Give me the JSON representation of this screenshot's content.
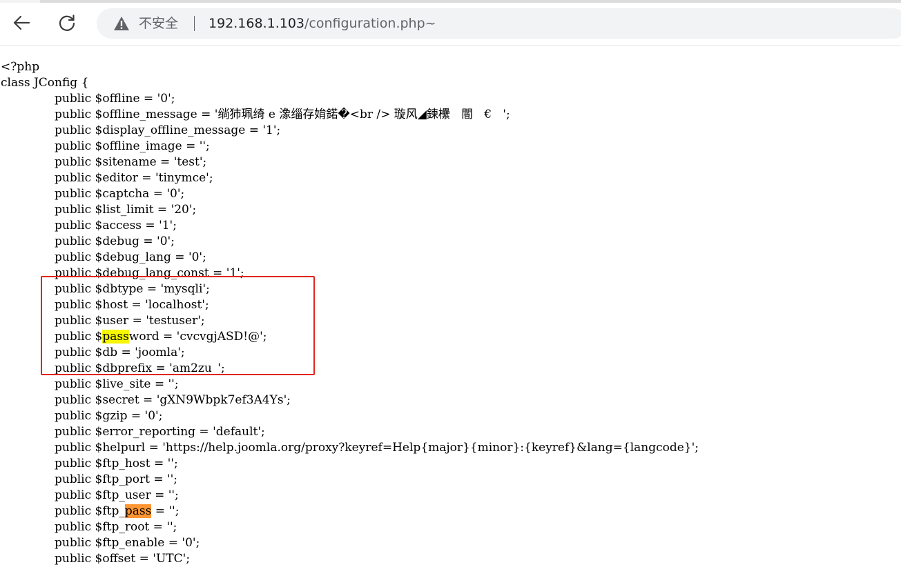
{
  "browser": {
    "security_label": "不安全",
    "url_host": "192.168.1.103",
    "url_path": "/configuration.php~"
  },
  "document": {
    "lines": [
      {
        "pre": "<?php",
        "mark": "",
        "post": "",
        "indent": false
      },
      {
        "pre": "class JConfig {",
        "mark": "",
        "post": "",
        "indent": false
      },
      {
        "pre": "public $offline = '0';",
        "mark": "",
        "post": "",
        "indent": true
      },
      {
        "pre": "public $offline_message = '绱犻珮绮 e 潒缁存姢鍩�<br /> 璇风◢鍊欙   閽   €   ';",
        "mark": "",
        "post": "",
        "indent": true
      },
      {
        "pre": "public $display_offline_message = '1';",
        "mark": "",
        "post": "",
        "indent": true
      },
      {
        "pre": "public $offline_image = '';",
        "mark": "",
        "post": "",
        "indent": true
      },
      {
        "pre": "public $sitename = 'test';",
        "mark": "",
        "post": "",
        "indent": true
      },
      {
        "pre": "public $editor = 'tinymce';",
        "mark": "",
        "post": "",
        "indent": true
      },
      {
        "pre": "public $captcha = '0';",
        "mark": "",
        "post": "",
        "indent": true
      },
      {
        "pre": "public $list_limit = '20';",
        "mark": "",
        "post": "",
        "indent": true
      },
      {
        "pre": "public $access = '1';",
        "mark": "",
        "post": "",
        "indent": true
      },
      {
        "pre": "public $debug = '0';",
        "mark": "",
        "post": "",
        "indent": true
      },
      {
        "pre": "public $debug_lang = '0';",
        "mark": "",
        "post": "",
        "indent": true
      },
      {
        "pre": "public $debug_lang_const = '1';",
        "mark": "",
        "post": "",
        "indent": true
      },
      {
        "pre": "public $dbtype = 'mysqli';",
        "mark": "",
        "post": "",
        "indent": true
      },
      {
        "pre": "public $host = 'localhost';",
        "mark": "",
        "post": "",
        "indent": true
      },
      {
        "pre": "public $user = 'testuser';",
        "mark": "",
        "post": "",
        "indent": true
      },
      {
        "pre": "public $",
        "mark": "pass",
        "post": "word = 'cvcvgjASD!@';",
        "indent": true,
        "mark_color": "yellow"
      },
      {
        "pre": "public $db = 'joomla';",
        "mark": "",
        "post": "",
        "indent": true
      },
      {
        "pre": "public $dbprefix = 'am2zu_';",
        "mark": "",
        "post": "",
        "indent": true
      },
      {
        "pre": "public $live_site = '';",
        "mark": "",
        "post": "",
        "indent": true
      },
      {
        "pre": "public $secret = 'gXN9Wbpk7ef3A4Ys';",
        "mark": "",
        "post": "",
        "indent": true
      },
      {
        "pre": "public $gzip = '0';",
        "mark": "",
        "post": "",
        "indent": true
      },
      {
        "pre": "public $error_reporting = 'default';",
        "mark": "",
        "post": "",
        "indent": true
      },
      {
        "pre": "public $helpurl = 'https://help.joomla.org/proxy?keyref=Help{major}{minor}:{keyref}&lang={langcode}';",
        "mark": "",
        "post": "",
        "indent": true
      },
      {
        "pre": "public $ftp_host = '';",
        "mark": "",
        "post": "",
        "indent": true
      },
      {
        "pre": "public $ftp_port = '';",
        "mark": "",
        "post": "",
        "indent": true
      },
      {
        "pre": "public $ftp_user = '';",
        "mark": "",
        "post": "",
        "indent": true
      },
      {
        "pre": "public $ftp_",
        "mark": "pass",
        "post": " = '';",
        "indent": true,
        "mark_color": "orange"
      },
      {
        "pre": "public $ftp_root = '';",
        "mark": "",
        "post": "",
        "indent": true
      },
      {
        "pre": "public $ftp_enable = '0';",
        "mark": "",
        "post": "",
        "indent": true
      },
      {
        "pre": "public $offset = 'UTC';",
        "mark": "",
        "post": "",
        "indent": true
      }
    ]
  },
  "annotation": {
    "color": "#e0251b"
  },
  "colors": {
    "highlight_current": "#ff9632",
    "highlight_match": "#f7f700"
  }
}
